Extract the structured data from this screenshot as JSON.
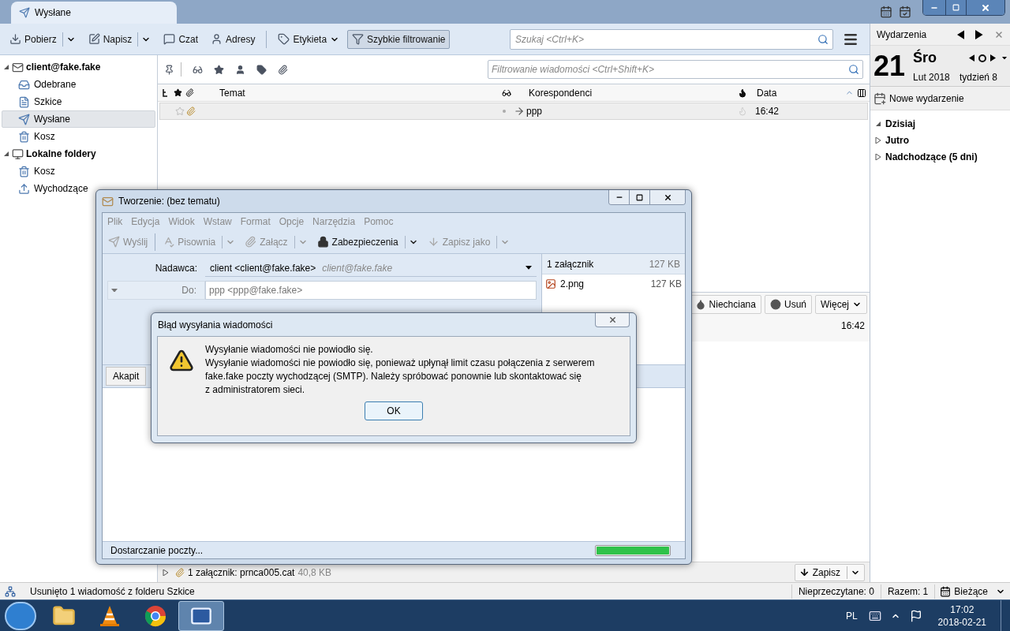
{
  "tab": {
    "label": "Wysłane",
    "selected": true
  },
  "toolbar": {
    "buttons": [
      {
        "label": "Pobierz",
        "kind": "split",
        "pressed": false
      },
      {
        "label": "Napisz",
        "kind": "split",
        "pressed": false
      },
      {
        "label": "Czat",
        "kind": "plain",
        "pressed": false
      },
      {
        "label": "Adresy",
        "kind": "plain",
        "pressed": false
      },
      {
        "label": "Etykieta",
        "kind": "menu",
        "pressed": false
      },
      {
        "label": "Szybkie filtrowanie",
        "kind": "plain",
        "pressed": true
      }
    ],
    "search": {
      "placeholder": "Szukaj <Ctrl+K>"
    }
  },
  "folders": [
    {
      "label": "client@fake.fake",
      "kind": "mail-account",
      "expanded": true,
      "children": [
        {
          "label": "Odebrane",
          "kind": "inbox",
          "selected": false
        },
        {
          "label": "Szkice",
          "kind": "drafts",
          "selected": false
        },
        {
          "label": "Wysłane",
          "kind": "sent",
          "selected": true
        },
        {
          "label": "Kosz",
          "kind": "trash",
          "selected": false
        }
      ]
    },
    {
      "label": "Lokalne foldery",
      "kind": "local",
      "expanded": true,
      "children": [
        {
          "label": "Kosz",
          "kind": "trash",
          "selected": false
        },
        {
          "label": "Wychodzące",
          "kind": "outbox",
          "selected": false
        }
      ]
    }
  ],
  "message_list": {
    "filter": {
      "placeholder": "Filtrowanie wiadomości <Ctrl+Shift+K>"
    },
    "columns": [
      "Temat",
      "Korespondenci",
      "Data"
    ],
    "rows": [
      {
        "correspondent": "ppp",
        "date": "16:42",
        "selected": true,
        "starred": false,
        "has_attachment": true
      }
    ]
  },
  "preview": {
    "buttons": [
      "Niechciana",
      "Usuń",
      "Więcej"
    ],
    "time": "16:42",
    "attachment": {
      "summary": "1 załącznik: prnca005.cat",
      "size": "40,8 KB",
      "save": "Zapisz"
    }
  },
  "events": {
    "title": "Wydarzenia",
    "day": "21",
    "weekday": "Śro",
    "month": "Lut 2018",
    "week": "tydzień 8",
    "new_event": "Nowe wydarzenie",
    "groups": [
      {
        "label": "Dzisiaj",
        "expanded": true
      },
      {
        "label": "Jutro",
        "expanded": false
      },
      {
        "label": "Nadchodzące (5 dni)",
        "expanded": false
      }
    ]
  },
  "status_bar": {
    "message": "Usunięto 1 wiadomość z folderu Szkice",
    "unread": "Nieprzeczytane: 0",
    "total": "Razem: 1",
    "view": "Bieżące"
  },
  "compose": {
    "title": "Tworzenie: (bez tematu)",
    "menu": [
      "Plik",
      "Edycja",
      "Widok",
      "Wstaw",
      "Format",
      "Opcje",
      "Narzędzia",
      "Pomoc"
    ],
    "toolbar": [
      {
        "label": "Wyślij",
        "kind": "plain",
        "disabled": true
      },
      {
        "label": "Pisownia",
        "kind": "split",
        "disabled": true
      },
      {
        "label": "Załącz",
        "kind": "split",
        "disabled": true
      },
      {
        "label": "Zabezpieczenia",
        "kind": "split",
        "disabled": false
      },
      {
        "label": "Zapisz jako",
        "kind": "split",
        "disabled": true
      }
    ],
    "from_label": "Nadawca:",
    "from": "client <client@fake.fake>",
    "from_hint": "client@fake.fake",
    "to_label": "Do:",
    "to": "ppp <ppp@fake.fake>",
    "attachments": {
      "summary": "1 załącznik",
      "size": "127 KB",
      "files": [
        {
          "name": "2.png",
          "size": "127 KB"
        }
      ]
    },
    "paragraph_format": "Akapit",
    "status": "Dostarczanie poczty...",
    "progress": {
      "level": 1
    }
  },
  "dialog": {
    "title": "Błąd wysyłania wiadomości",
    "lines": [
      "Wysyłanie wiadomości nie powiodło się.",
      "Wysyłanie wiadomości nie powiodło się, ponieważ upłynął limit czasu połączenia z serwerem",
      "fake.fake poczty wychodzącej (SMTP). Należy spróbować ponownie lub skontaktować się",
      "z administratorem sieci."
    ],
    "button": "OK"
  },
  "taskbar": {
    "apps": [
      {
        "kind": "folder",
        "selected": false
      },
      {
        "kind": "cone",
        "selected": false
      },
      {
        "kind": "browser",
        "selected": false
      },
      {
        "kind": "mail",
        "selected": true
      }
    ],
    "language": "PL",
    "time": "17:02",
    "date": "2018-02-21"
  }
}
